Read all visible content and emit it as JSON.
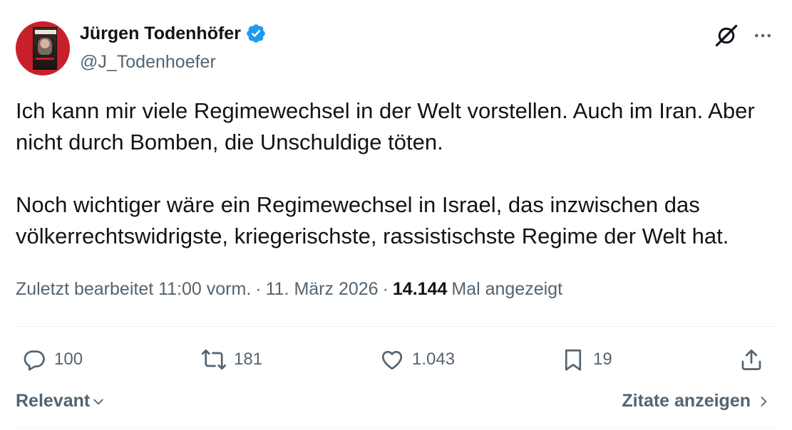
{
  "author": {
    "name": "Jürgen Todenhöfer",
    "handle": "@J_Todenhoefer",
    "verified": true
  },
  "tweet": {
    "paragraphs": [
      "Ich kann mir viele Regimewechsel in der Welt vorstellen. Auch im Iran. Aber nicht durch Bomben, die Unschuldige töten.",
      "Noch wichtiger wäre ein Regimewechsel in Israel, das inzwischen das völkerrechtswidrigste, kriegerischste, rassistischste Regime der Welt hat."
    ]
  },
  "meta": {
    "edited_label": "Zuletzt bearbeitet 11:00 vorm.",
    "separator": "·",
    "date": "11. März 2026",
    "views_count": "14.144",
    "views_label": "Mal angezeigt"
  },
  "actions": {
    "replies": "100",
    "reposts": "181",
    "likes": "1.043",
    "bookmarks": "19"
  },
  "footer": {
    "sort_label": "Relevant",
    "quotes_label": "Zitate anzeigen"
  },
  "colors": {
    "text": "#0f1419",
    "secondary": "#536471",
    "verified": "#1d9bf0",
    "divider": "#eff3f4"
  },
  "icons": [
    "verified-badge-icon",
    "grok-icon",
    "more-icon",
    "reply-icon",
    "repost-icon",
    "like-icon",
    "bookmark-icon",
    "share-icon",
    "chevron-down-icon",
    "chevron-right-icon"
  ]
}
